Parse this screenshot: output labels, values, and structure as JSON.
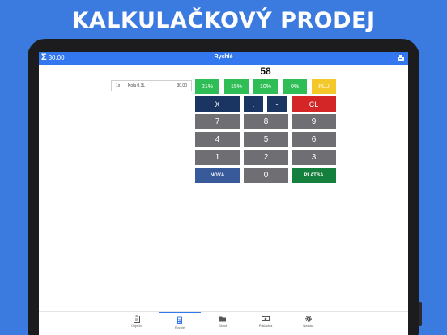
{
  "headline": "KALKULAČKOVÝ PRODEJ",
  "appbar": {
    "total": "30.00",
    "title": "Rychlé"
  },
  "receipt": {
    "items": [
      {
        "qty": "1x",
        "name": "Kola 0,3L",
        "price": "30.00"
      }
    ]
  },
  "display": {
    "amount": "58"
  },
  "keypad": {
    "pct21": "21%",
    "pct15": "15%",
    "pct10": "10%",
    "pct0": "0%",
    "plu": "PLU",
    "times": "X",
    "dot": ".",
    "minus": "-",
    "clear": "CL",
    "k7": "7",
    "k8": "8",
    "k9": "9",
    "k4": "4",
    "k5": "5",
    "k6": "6",
    "k1": "1",
    "k2": "2",
    "k3": "3",
    "new": "NOVÁ",
    "k0": "0",
    "pay": "PLATBA"
  },
  "nav": {
    "orders": "Objedn.",
    "quick": "Rychlé",
    "stock": "Sklad",
    "receipts": "Pokladna",
    "settings": "Nastav."
  },
  "colors": {
    "background": "#3b7be0",
    "appbar": "#3478f0",
    "percent_keys": "#2fbd55",
    "plu_key": "#f5c82a",
    "operator_keys": "#1a3561",
    "clear_key": "#d42626",
    "digit_keys": "#6e6e73",
    "new_key": "#385a9a",
    "pay_key": "#15803d"
  },
  "icons": {
    "total": "sigma-icon",
    "appbar_right": "cash-register-icon",
    "nav": [
      "clipboard-icon",
      "calculator-icon",
      "folder-icon",
      "banknote-icon",
      "gear-icon"
    ]
  }
}
